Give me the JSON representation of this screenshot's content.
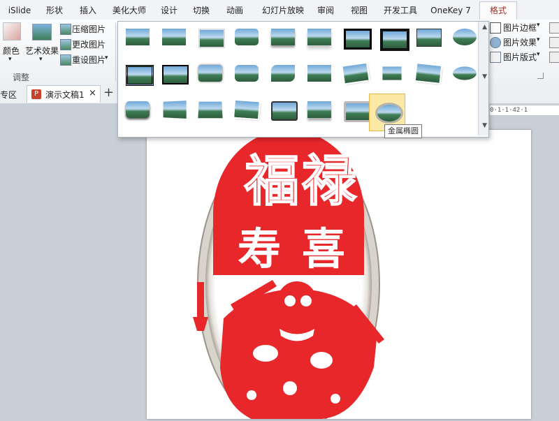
{
  "ribbon_tabs": [
    "iSlide",
    "形状",
    "插入",
    "美化大师",
    "设计",
    "切换",
    "动画",
    "幻灯片放映",
    "审阅",
    "视图",
    "开发工具",
    "OneKey 7",
    "格式"
  ],
  "ribbon": {
    "color_label": "颜色",
    "art_effects_label": "艺术效果",
    "compress_label": "压缩图片",
    "change_label": "更改图片",
    "reset_label": "重设图片",
    "group_adjust": "调整",
    "border_label": "图片边框",
    "effects_label": "图片效果",
    "layout_label": "图片版式"
  },
  "doc_tabs": {
    "left_partial": "专区",
    "doc_name": "演示文稿1",
    "close_glyph": "×",
    "add_glyph": "+"
  },
  "ruler_text": "0·1·1·42·1",
  "gallery": {
    "tooltip": "金属椭圆",
    "styles_count_visible": 27,
    "selected_index": 26
  },
  "slide": {
    "artwork_text": "福禄寿喜"
  },
  "colors": {
    "accent_tab": "#a23027",
    "paper_cut_red": "#e8272b",
    "gallery_selected": "#fde9a6"
  }
}
